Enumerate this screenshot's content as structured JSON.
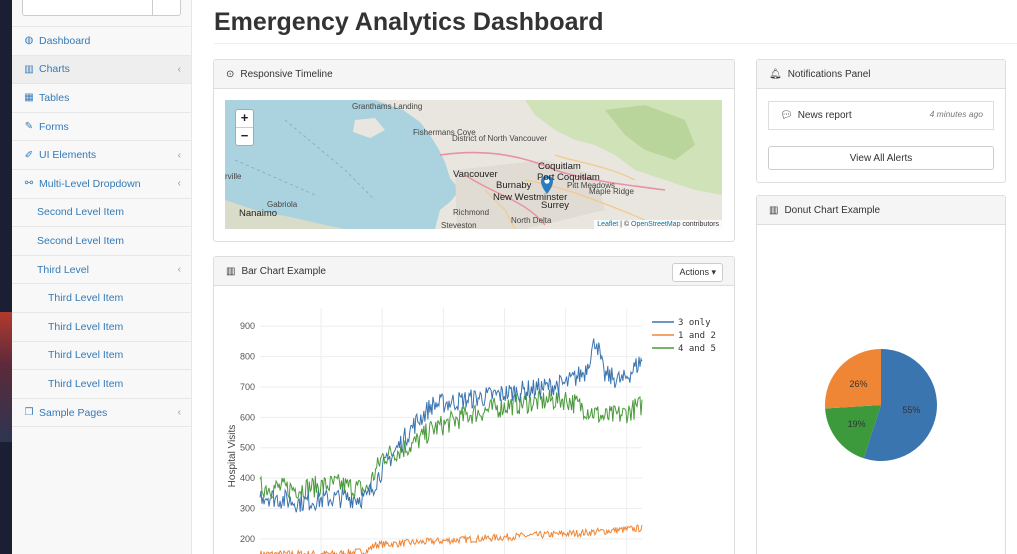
{
  "app": {
    "title": "Emergency Analytics Dashboard"
  },
  "sidebar": {
    "items": [
      {
        "label": "Dashboard",
        "icon": "dashboard-icon",
        "chevron": false
      },
      {
        "label": "Charts",
        "icon": "bar-chart-icon",
        "chevron": true
      },
      {
        "label": "Tables",
        "icon": "table-icon",
        "chevron": false
      },
      {
        "label": "Forms",
        "icon": "edit-icon",
        "chevron": false
      },
      {
        "label": "UI Elements",
        "icon": "wrench-icon",
        "chevron": true
      },
      {
        "label": "Multi-Level Dropdown",
        "icon": "sitemap-icon",
        "chevron": true
      },
      {
        "label": "Second Level Item"
      },
      {
        "label": "Second Level Item"
      },
      {
        "label": "Third Level",
        "chevron": true
      },
      {
        "label": "Third Level Item"
      },
      {
        "label": "Third Level Item"
      },
      {
        "label": "Third Level Item"
      },
      {
        "label": "Third Level Item"
      },
      {
        "label": "Sample Pages",
        "icon": "files-icon",
        "chevron": true
      }
    ]
  },
  "timeline_panel": {
    "title": "Responsive Timeline",
    "map": {
      "zoom_in": "+",
      "zoom_out": "−",
      "labels": [
        "Granthams Landing",
        "Fishermans Cove",
        "District of North Vancouver",
        "Vancouver",
        "Coquitlam",
        "Port Coquitlam",
        "Burnaby",
        "Pitt Meadows",
        "Maple Ridge",
        "New Westminster",
        "Surrey",
        "Richmond",
        "North Delta",
        "Steveston",
        "Gabriola",
        "Nanaimo",
        "rville"
      ],
      "attribution": {
        "leaflet": "Leaflet",
        "sep": " | © ",
        "osm": "OpenStreetMap",
        "tail": " contributors"
      }
    }
  },
  "bar_chart_panel": {
    "title": "Bar Chart Example",
    "actions_label": "Actions ▾"
  },
  "notifications_panel": {
    "title": "Notifications Panel",
    "items": [
      {
        "text": "News report",
        "time": "4 minutes ago"
      }
    ],
    "view_all": "View All Alerts"
  },
  "donut_panel": {
    "title": "Donut Chart Example"
  },
  "chart_data": [
    {
      "type": "line",
      "title": "",
      "xlabel": "",
      "ylabel": "Hospital Visits",
      "ylim": [
        150,
        960
      ],
      "yticks": [
        200,
        300,
        400,
        500,
        600,
        700,
        800,
        900
      ],
      "grid": true,
      "legend": "top-right",
      "colors": [
        "#3a75b0",
        "#ef8636",
        "#4a9a3c"
      ],
      "series": [
        {
          "name": "3 only",
          "description": "noisy daily series ~320 rising to ~700, peaks near 940",
          "anchors": [
            [
              0,
              345
            ],
            [
              10,
              320
            ],
            [
              20,
              335
            ],
            [
              28,
              335
            ],
            [
              32,
              430
            ],
            [
              40,
              570
            ],
            [
              45,
              640
            ],
            [
              55,
              660
            ],
            [
              65,
              680
            ],
            [
              75,
              700
            ],
            [
              80,
              710
            ],
            [
              85,
              750
            ],
            [
              88,
              860
            ],
            [
              90,
              740
            ],
            [
              95,
              720
            ],
            [
              100,
              790
            ]
          ]
        },
        {
          "name": "1 and 2",
          "description": "low noisy series ~170 to ~240",
          "anchors": [
            [
              0,
              150
            ],
            [
              20,
              150
            ],
            [
              28,
              160
            ],
            [
              30,
              180
            ],
            [
              50,
              195
            ],
            [
              70,
              210
            ],
            [
              85,
              220
            ],
            [
              100,
              235
            ]
          ]
        },
        {
          "name": "4 and 5",
          "description": "noisy daily series ~330 rising to ~650",
          "anchors": [
            [
              0,
              370
            ],
            [
              10,
              365
            ],
            [
              20,
              380
            ],
            [
              28,
              360
            ],
            [
              32,
              470
            ],
            [
              40,
              510
            ],
            [
              45,
              560
            ],
            [
              55,
              610
            ],
            [
              65,
              640
            ],
            [
              75,
              655
            ],
            [
              80,
              660
            ],
            [
              85,
              630
            ],
            [
              90,
              600
            ],
            [
              95,
              610
            ],
            [
              100,
              640
            ]
          ]
        }
      ]
    },
    {
      "type": "pie",
      "labels": [
        "55%",
        "19%",
        "26%"
      ],
      "values": [
        55,
        19,
        26
      ],
      "colors": [
        "#3a75b0",
        "#3c9a3c",
        "#ef8636"
      ]
    }
  ]
}
